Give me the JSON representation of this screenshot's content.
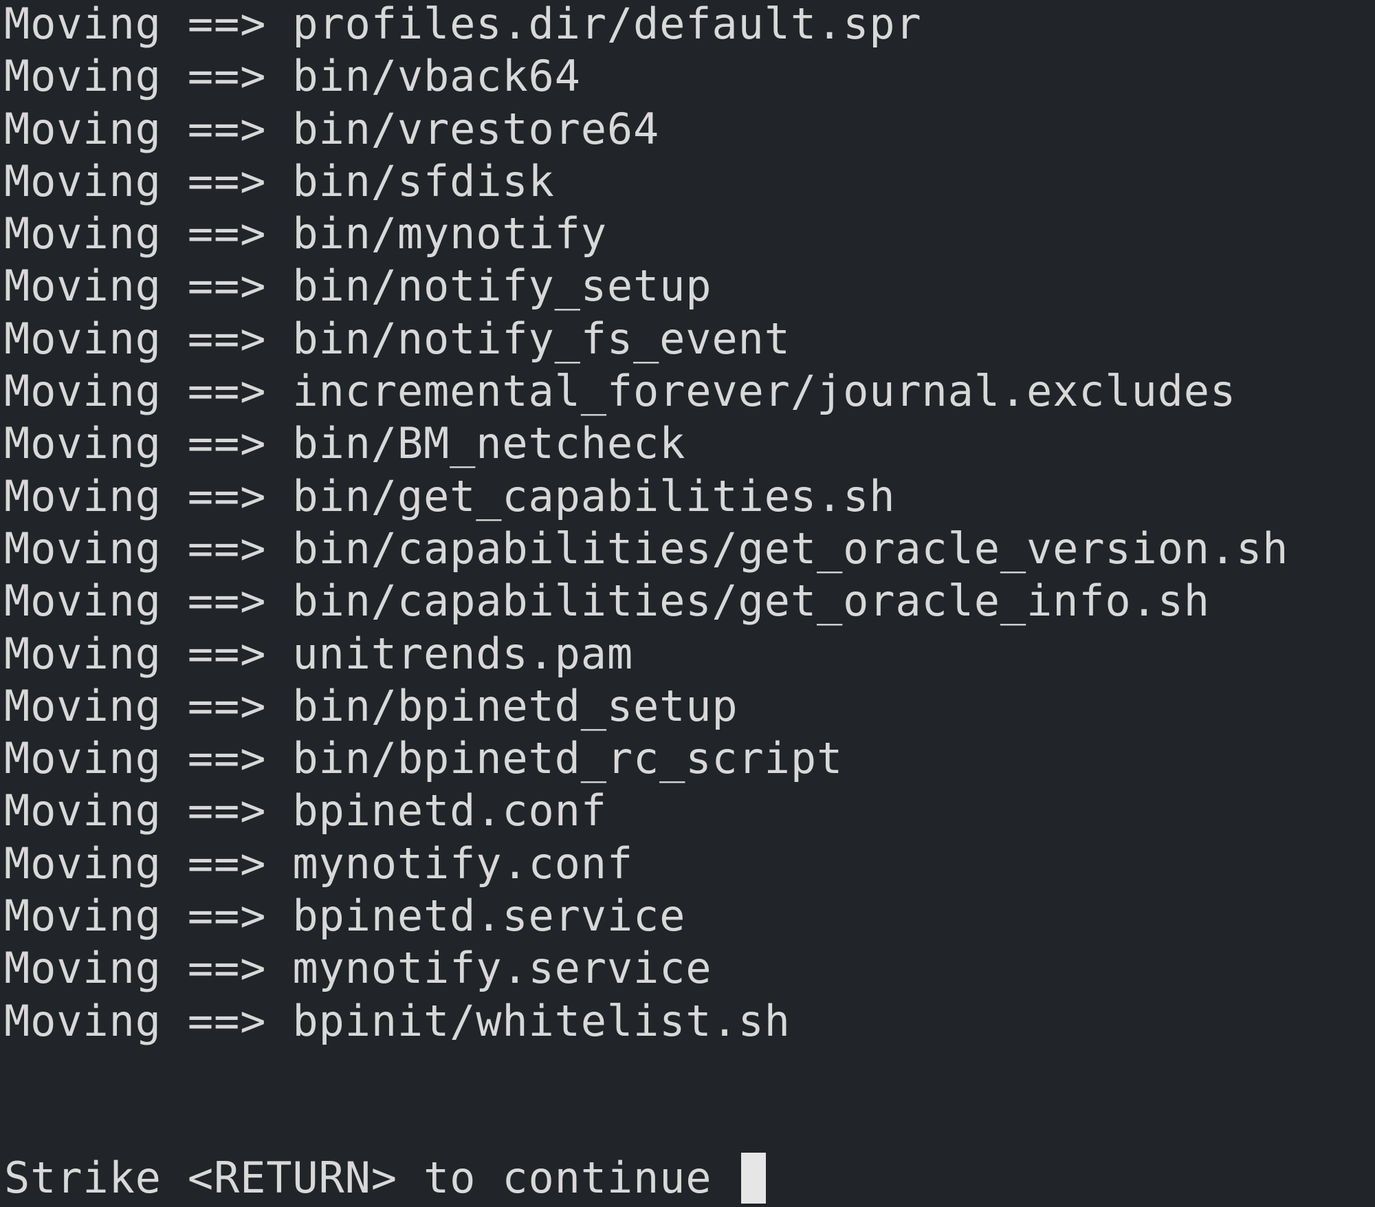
{
  "terminal": {
    "lines": [
      "Moving ==> profiles.dir/default.spr",
      "Moving ==> bin/vback64",
      "Moving ==> bin/vrestore64",
      "Moving ==> bin/sfdisk",
      "Moving ==> bin/mynotify",
      "Moving ==> bin/notify_setup",
      "Moving ==> bin/notify_fs_event",
      "Moving ==> incremental_forever/journal.excludes",
      "Moving ==> bin/BM_netcheck",
      "Moving ==> bin/get_capabilities.sh",
      "Moving ==> bin/capabilities/get_oracle_version.sh",
      "Moving ==> bin/capabilities/get_oracle_info.sh",
      "Moving ==> unitrends.pam",
      "Moving ==> bin/bpinetd_setup",
      "Moving ==> bin/bpinetd_rc_script",
      "Moving ==> bpinetd.conf",
      "Moving ==> mynotify.conf",
      "Moving ==> bpinetd.service",
      "Moving ==> mynotify.service",
      "Moving ==> bpinit/whitelist.sh"
    ],
    "prompt": "Strike <RETURN> to continue ",
    "colors": {
      "background": "#212428",
      "text": "#d8d8d8",
      "cursor": "#e6e6e6"
    }
  }
}
